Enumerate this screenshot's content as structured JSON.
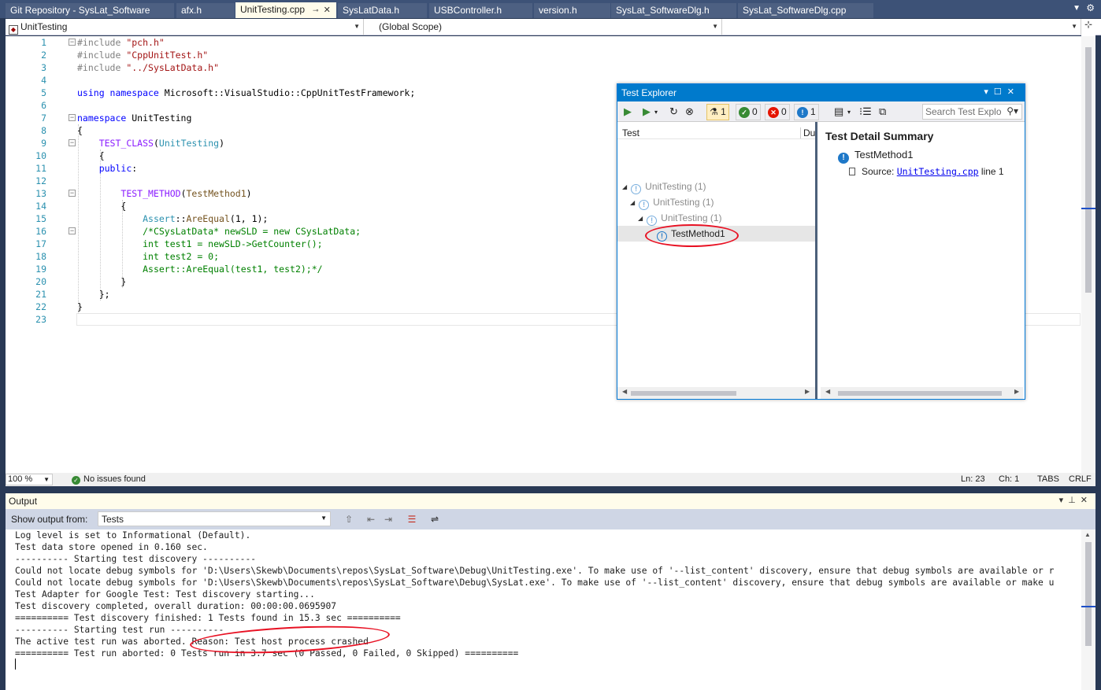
{
  "tabs": [
    {
      "label": "Git Repository - SysLat_Software"
    },
    {
      "label": "afx.h"
    },
    {
      "label": "UnitTesting.cpp"
    },
    {
      "label": "SysLatData.h"
    },
    {
      "label": "USBController.h"
    },
    {
      "label": "version.h"
    },
    {
      "label": "SysLat_SoftwareDlg.h"
    },
    {
      "label": "SysLat_SoftwareDlg.cpp"
    }
  ],
  "navbar": {
    "project": "UnitTesting",
    "scope": "(Global Scope)",
    "member": ""
  },
  "editor": {
    "line_numbers": [
      "1",
      "2",
      "3",
      "4",
      "5",
      "6",
      "7",
      "8",
      "9",
      "10",
      "11",
      "12",
      "13",
      "14",
      "15",
      "16",
      "17",
      "18",
      "19",
      "20",
      "21",
      "22",
      "23"
    ],
    "zoom": "100 %",
    "issues": "No issues found",
    "ln": "Ln: 23",
    "ch": "Ch: 1",
    "tabs_mode": "TABS",
    "line_ending": "CRLF"
  },
  "output": {
    "title": "Output",
    "show_from_label": "Show output from:",
    "source": "Tests",
    "lines": [
      "Log level is set to Informational (Default).",
      "Test data store opened in 0.160 sec.",
      "---------- Starting test discovery ----------",
      "Could not locate debug symbols for 'D:\\Users\\Skewb\\Documents\\repos\\SysLat_Software\\Debug\\UnitTesting.exe'. To make use of '--list_content' discovery, ensure that debug symbols are available or r",
      "Could not locate debug symbols for 'D:\\Users\\Skewb\\Documents\\repos\\SysLat_Software\\Debug\\SysLat.exe'. To make use of '--list_content' discovery, ensure that debug symbols are available or make u",
      "Test Adapter for Google Test: Test discovery starting...",
      "Test discovery completed, overall duration: 00:00:00.0695907",
      "========== Test discovery finished: 1 Tests found in 15.3 sec ==========",
      "---------- Starting test run ----------",
      "The active test run was aborted. Reason: Test host process crashed",
      "========== Test run aborted: 0 Tests run in 3.7 sec (0 Passed, 0 Failed, 0 Skipped) =========="
    ]
  },
  "test_explorer": {
    "title": "Test Explorer",
    "counts": {
      "total": "1",
      "passed": "0",
      "failed": "0",
      "not_run": "1"
    },
    "search_placeholder": "Search Test Explo",
    "col_test": "Test",
    "col_duration": "Du",
    "tree": [
      {
        "label": "UnitTesting  (1)"
      },
      {
        "label": "UnitTesting  (1)"
      },
      {
        "label": "UnitTesting  (1)"
      },
      {
        "label": "TestMethod1"
      }
    ],
    "detail": {
      "heading": "Test Detail Summary",
      "test_name": "TestMethod1",
      "source_label": "Source:",
      "source_file": "UnitTesting.cpp",
      "source_line": "line 1"
    }
  },
  "colors": {
    "accent": "#007acc",
    "annotation": "#e81123",
    "success": "#388a34",
    "error": "#e51400",
    "info": "#1e78c8"
  }
}
